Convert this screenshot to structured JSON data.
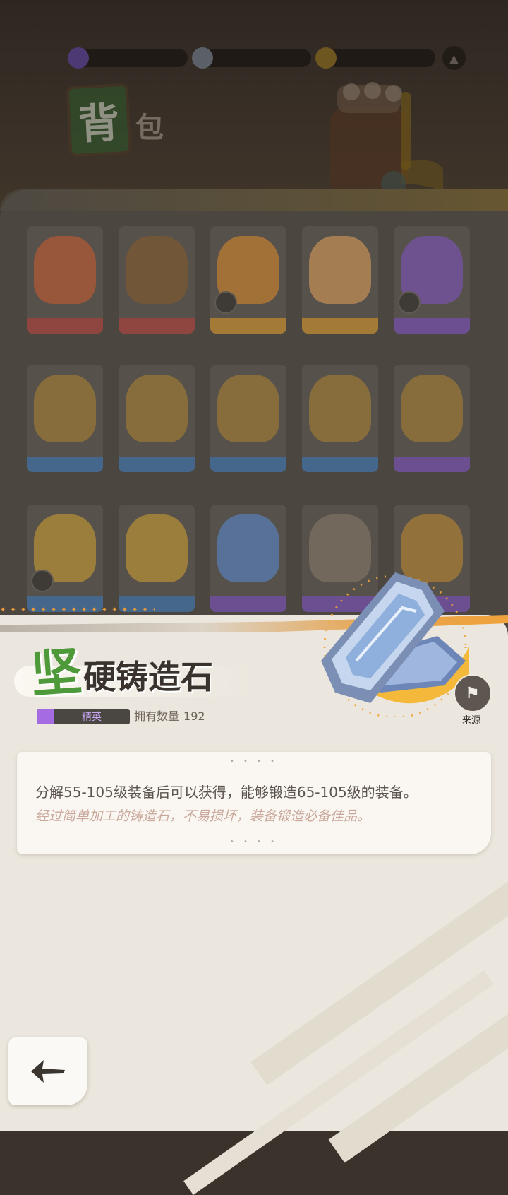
{
  "currency": {
    "items": [
      {
        "icon": "purple-crystal-icon",
        "value": "",
        "color": "#7b55c9"
      },
      {
        "icon": "diamond-icon",
        "value": "",
        "color": "#b8c4d8"
      },
      {
        "icon": "gold-coin-icon",
        "value": "",
        "color": "#d6a632"
      }
    ]
  },
  "background": {
    "title_main": "背",
    "title_sub": "包"
  },
  "inventory": {
    "rows": [
      [
        {
          "color": "#d05a2e",
          "band": "#b6403b",
          "count": ""
        },
        {
          "color": "#8a5a2a",
          "band": "#b6403b",
          "count": ""
        },
        {
          "color": "#e08a2a",
          "band": "#d9962a",
          "count": ""
        },
        {
          "color": "#e6a35a",
          "band": "#d9962a",
          "count": ""
        },
        {
          "color": "#8452c8",
          "band": "#7b4fc0",
          "count": ""
        }
      ],
      [
        {
          "color": "#b08232",
          "band": "#3a77b8",
          "count": ""
        },
        {
          "color": "#b08232",
          "band": "#3a77b8",
          "count": ""
        },
        {
          "color": "#b08232",
          "band": "#3a77b8",
          "count": ""
        },
        {
          "color": "#b08232",
          "band": "#3a77b8",
          "count": ""
        },
        {
          "color": "#b08232",
          "band": "#7b4fc0",
          "count": ""
        }
      ],
      [
        {
          "color": "#d6a032",
          "band": "#3a77b8",
          "count": ""
        },
        {
          "color": "#d6a032",
          "band": "#3a77b8",
          "count": ""
        },
        {
          "color": "#5a8ad8",
          "band": "#7b4fc0",
          "count": ""
        },
        {
          "color": "#8c7a6c",
          "band": "#7b4fc0",
          "count": ""
        },
        {
          "color": "#c48a30",
          "band": "#7b4fc0",
          "count": ""
        }
      ]
    ]
  },
  "item": {
    "name_first": "坚",
    "name_rest": "硬铸造石",
    "rarity": "精英",
    "rarity_color": "#a56be0",
    "owned_label": "拥有数量",
    "owned_count": "192",
    "source_label": "来源",
    "description": "分解55-105级装备后可以获得，能够锻造65-105级的装备。",
    "flavor": "经过简单加工的铸造石，不易损坏，装备锻造必备佳品。"
  },
  "decor": {
    "dots": "• • • •"
  },
  "accent": "#f0a33c"
}
